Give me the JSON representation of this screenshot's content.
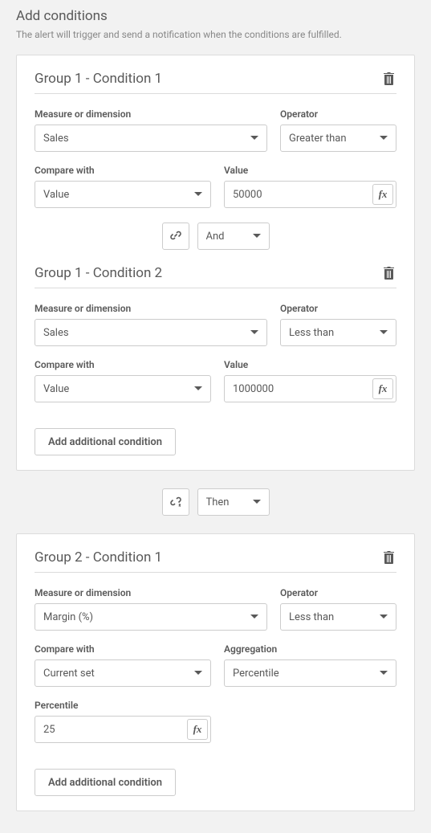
{
  "header": {
    "title": "Add conditions",
    "subtitle": "The alert will trigger and send a notification when the conditions are fulfilled."
  },
  "labels": {
    "measure": "Measure or dimension",
    "operator": "Operator",
    "compare": "Compare with",
    "value": "Value",
    "aggregation": "Aggregation",
    "percentile": "Percentile",
    "add_condition": "Add additional condition",
    "fx": "fx"
  },
  "group1": {
    "cond1": {
      "title": "Group 1 - Condition 1",
      "measure": "Sales",
      "operator": "Greater than",
      "compare": "Value",
      "value": "50000"
    },
    "connector": "And",
    "cond2": {
      "title": "Group 1 - Condition 2",
      "measure": "Sales",
      "operator": "Less than",
      "compare": "Value",
      "value": "1000000"
    }
  },
  "outer_connector": "Then",
  "group2": {
    "cond1": {
      "title": "Group 2 - Condition 1",
      "measure": "Margin (%)",
      "operator": "Less than",
      "compare": "Current set",
      "aggregation": "Percentile",
      "percentile": "25"
    }
  }
}
